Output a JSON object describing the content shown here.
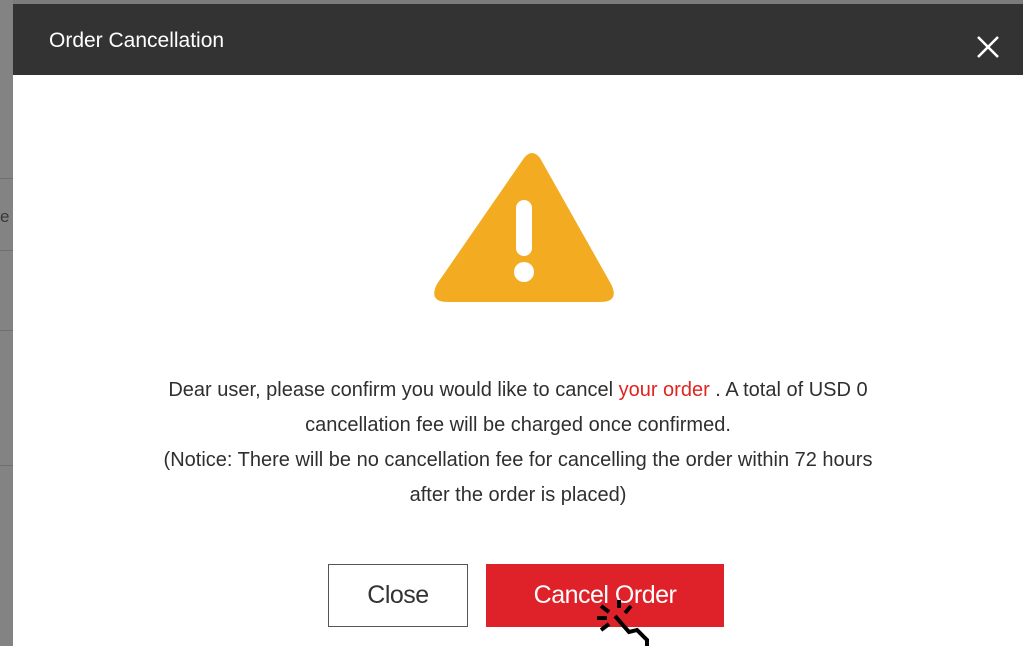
{
  "dialog": {
    "title": "Order Cancellation",
    "message_part1": "Dear user, please confirm you would like to cancel ",
    "message_link": "your order",
    "message_part2": " . A total of USD 0",
    "message_line2": "cancellation fee will be charged once confirmed.",
    "notice_line1": "(Notice: There will be no cancellation fee for cancelling the order within 72 hours",
    "notice_line2": "after the order is placed)",
    "close_label": "Close",
    "cancel_order_label": "Cancel Order"
  },
  "background": {
    "partial_text": "e"
  },
  "colors": {
    "header_bg": "#333333",
    "warning": "#f3ac22",
    "danger": "#df2229",
    "link_red": "#e0241f"
  },
  "icons": {
    "close": "close-icon",
    "warning": "warning-triangle-icon",
    "cursor": "hand-pointer-cursor-icon"
  }
}
